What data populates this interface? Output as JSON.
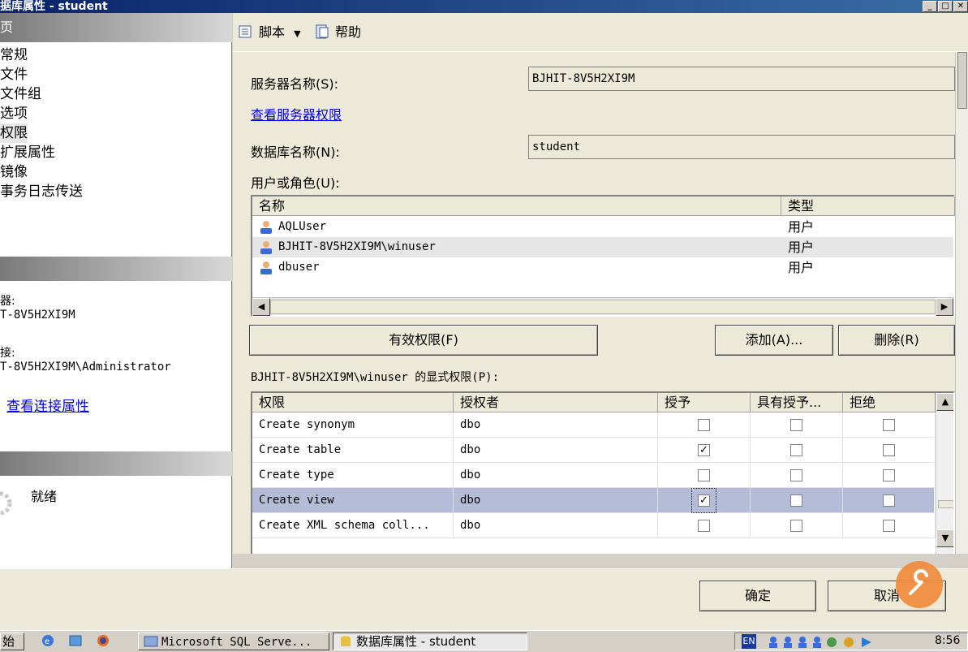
{
  "window": {
    "title": "据库属性 - student",
    "buttons": [
      "_",
      "□",
      "✕"
    ]
  },
  "left_pane": {
    "select_page_header": "页",
    "nav_items": [
      {
        "label": "常规",
        "selected": false
      },
      {
        "label": "文件",
        "selected": false
      },
      {
        "label": "文件组",
        "selected": false
      },
      {
        "label": "选项",
        "selected": false
      },
      {
        "label": "权限",
        "selected": true
      },
      {
        "label": "扩展属性",
        "selected": false
      },
      {
        "label": "镜像",
        "selected": false
      },
      {
        "label": "事务日志传送",
        "selected": false
      }
    ],
    "connection": {
      "server_label": "器:",
      "server_value": "T-8V5H2XI9M",
      "connection_label": "接:",
      "connection_value": "T-8V5H2XI9M\\Administrator",
      "view_link": "查看连接属性"
    },
    "progress": {
      "status": "就绪"
    }
  },
  "toolbar": {
    "script_label": "脚本",
    "help_label": "帮助"
  },
  "form": {
    "server_name_label": "服务器名称(S):",
    "server_name_value": "BJHIT-8V5H2XI9M",
    "view_server_perms_link": "查看服务器权限",
    "db_name_label": "数据库名称(N):",
    "db_name_value": "student",
    "users_roles_label": "用户或角色(U):",
    "users_columns": [
      "名称",
      "类型"
    ],
    "users": [
      {
        "name": "AQLUser",
        "type": "用户",
        "selected": false
      },
      {
        "name": "BJHIT-8V5H2XI9M\\winuser",
        "type": "用户",
        "selected": true
      },
      {
        "name": "dbuser",
        "type": "用户",
        "selected": false
      }
    ],
    "effective_perms_button": "有效权限(F)",
    "add_button": "添加(A)...",
    "remove_button": "删除(R)",
    "explicit_perms_label": "BJHIT-8V5H2XI9M\\winuser 的显式权限(P):",
    "perm_columns": [
      "权限",
      "授权者",
      "授予",
      "具有授予...",
      "拒绝"
    ],
    "permissions": [
      {
        "permission": "Create synonym",
        "grantor": "dbo",
        "grant": false,
        "with_grant": false,
        "deny": false,
        "selected": false
      },
      {
        "permission": "Create table",
        "grantor": "dbo",
        "grant": true,
        "with_grant": false,
        "deny": false,
        "selected": false
      },
      {
        "permission": "Create type",
        "grantor": "dbo",
        "grant": false,
        "with_grant": false,
        "deny": false,
        "selected": false
      },
      {
        "permission": "Create view",
        "grantor": "dbo",
        "grant": true,
        "with_grant": false,
        "deny": false,
        "selected": true
      },
      {
        "permission": "Create XML schema coll...",
        "grantor": "dbo",
        "grant": false,
        "with_grant": false,
        "deny": false,
        "selected": false
      }
    ]
  },
  "footer": {
    "ok_button": "确定",
    "cancel_button": "取消"
  },
  "taskbar": {
    "start_label": "始",
    "tasks": [
      {
        "label": "Microsoft SQL Serve...",
        "active": false
      },
      {
        "label": "数据库属性 - student",
        "active": true
      }
    ],
    "lang": "EN",
    "clock": "8:56"
  }
}
